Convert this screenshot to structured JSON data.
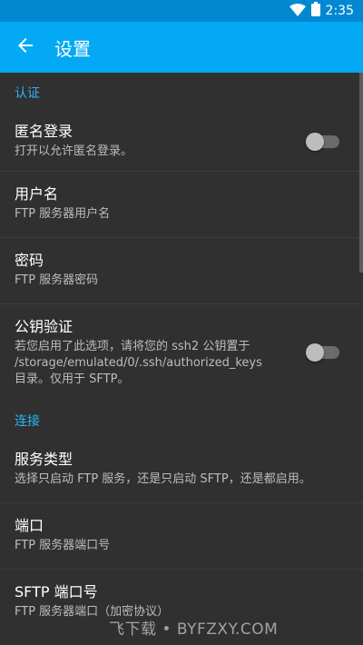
{
  "status": {
    "time": "2:35",
    "wifi_icon": "wifi-icon",
    "battery_icon": "battery-icon"
  },
  "appbar": {
    "back_icon": "arrow-back-icon",
    "title": "设置"
  },
  "sections": [
    {
      "header": "认证",
      "items": [
        {
          "title": "匿名登录",
          "summary": "打开以允许匿名登录。",
          "switch": false
        },
        {
          "title": "用户名",
          "summary": "FTP 服务器用户名"
        },
        {
          "title": "密码",
          "summary": "FTP 服务器密码"
        },
        {
          "title": "公钥验证",
          "summary": "若您启用了此选项，请将您的 ssh2 公钥置于 /storage/emulated/0/.ssh/authorized_keys 目录。仅用于 SFTP。",
          "switch": false
        }
      ]
    },
    {
      "header": "连接",
      "items": [
        {
          "title": "服务类型",
          "summary": "选择只启动 FTP 服务，还是只启动 SFTP，还是都启用。"
        },
        {
          "title": "端口",
          "summary": "FTP 服务器端口号"
        },
        {
          "title": "SFTP 端口号",
          "summary": "FTP 服务器端口（加密协议）"
        }
      ]
    }
  ],
  "watermark": "飞下载 • BYFZXY.COM",
  "colors": {
    "statusbar": "#0288d1",
    "appbar": "#03a9f4",
    "background": "#303030",
    "accent": "#29b6f6"
  }
}
